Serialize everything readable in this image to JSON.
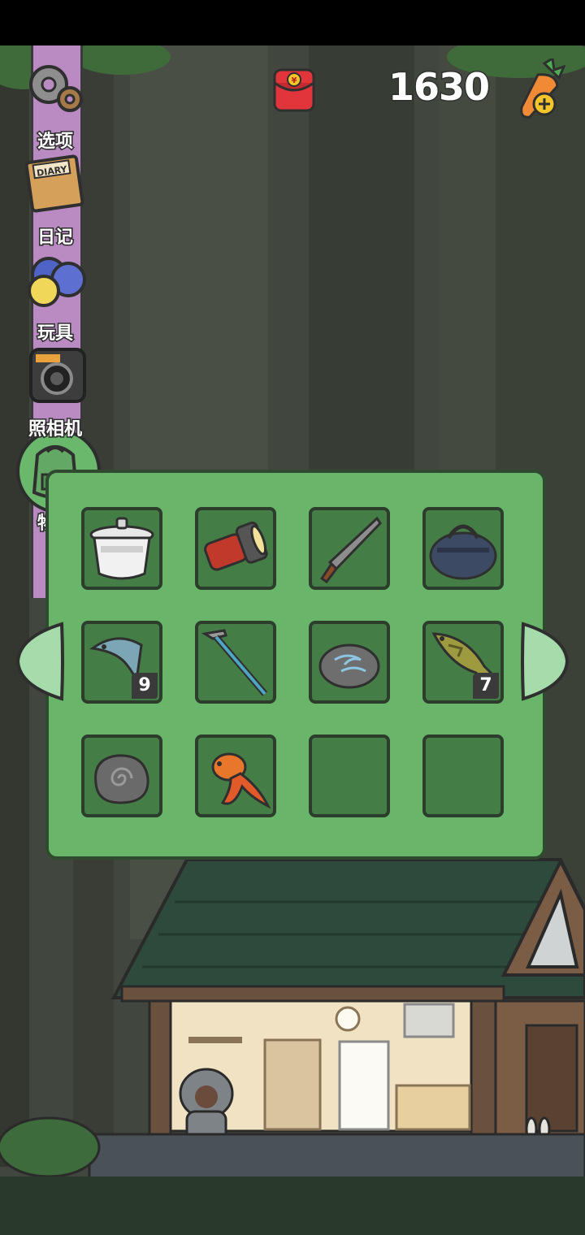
{
  "currency": {
    "count": "1630",
    "icon": "carrot-icon"
  },
  "menu": {
    "items": [
      {
        "label": "选项",
        "icon": "gear-icon"
      },
      {
        "label": "日记",
        "icon": "diary-icon",
        "icon_text": "DIARY"
      },
      {
        "label": "玩具",
        "icon": "toy-balls-icon"
      },
      {
        "label": "照相机",
        "icon": "camera-icon"
      },
      {
        "label": "物品",
        "icon": "backpack-icon",
        "active": true
      }
    ]
  },
  "inventory": {
    "slots": [
      {
        "item": "cooking-pot-icon",
        "qty": ""
      },
      {
        "item": "flashlight-icon",
        "qty": ""
      },
      {
        "item": "machete-icon",
        "qty": ""
      },
      {
        "item": "duffel-bag-icon",
        "qty": ""
      },
      {
        "item": "fish-bait-icon",
        "qty": "9"
      },
      {
        "item": "trekking-pole-icon",
        "qty": ""
      },
      {
        "item": "wind-stone-icon",
        "qty": ""
      },
      {
        "item": "bass-fish-icon",
        "qty": "7"
      },
      {
        "item": "spiral-stone-icon",
        "qty": ""
      },
      {
        "item": "goldfish-icon",
        "qty": ""
      },
      {
        "item": "",
        "qty": ""
      },
      {
        "item": "",
        "qty": ""
      }
    ]
  },
  "colors": {
    "panel": "#69b569",
    "slot": "#457d46",
    "menu_rail": "#b98bc2",
    "forest_bg": "#3a4038"
  }
}
